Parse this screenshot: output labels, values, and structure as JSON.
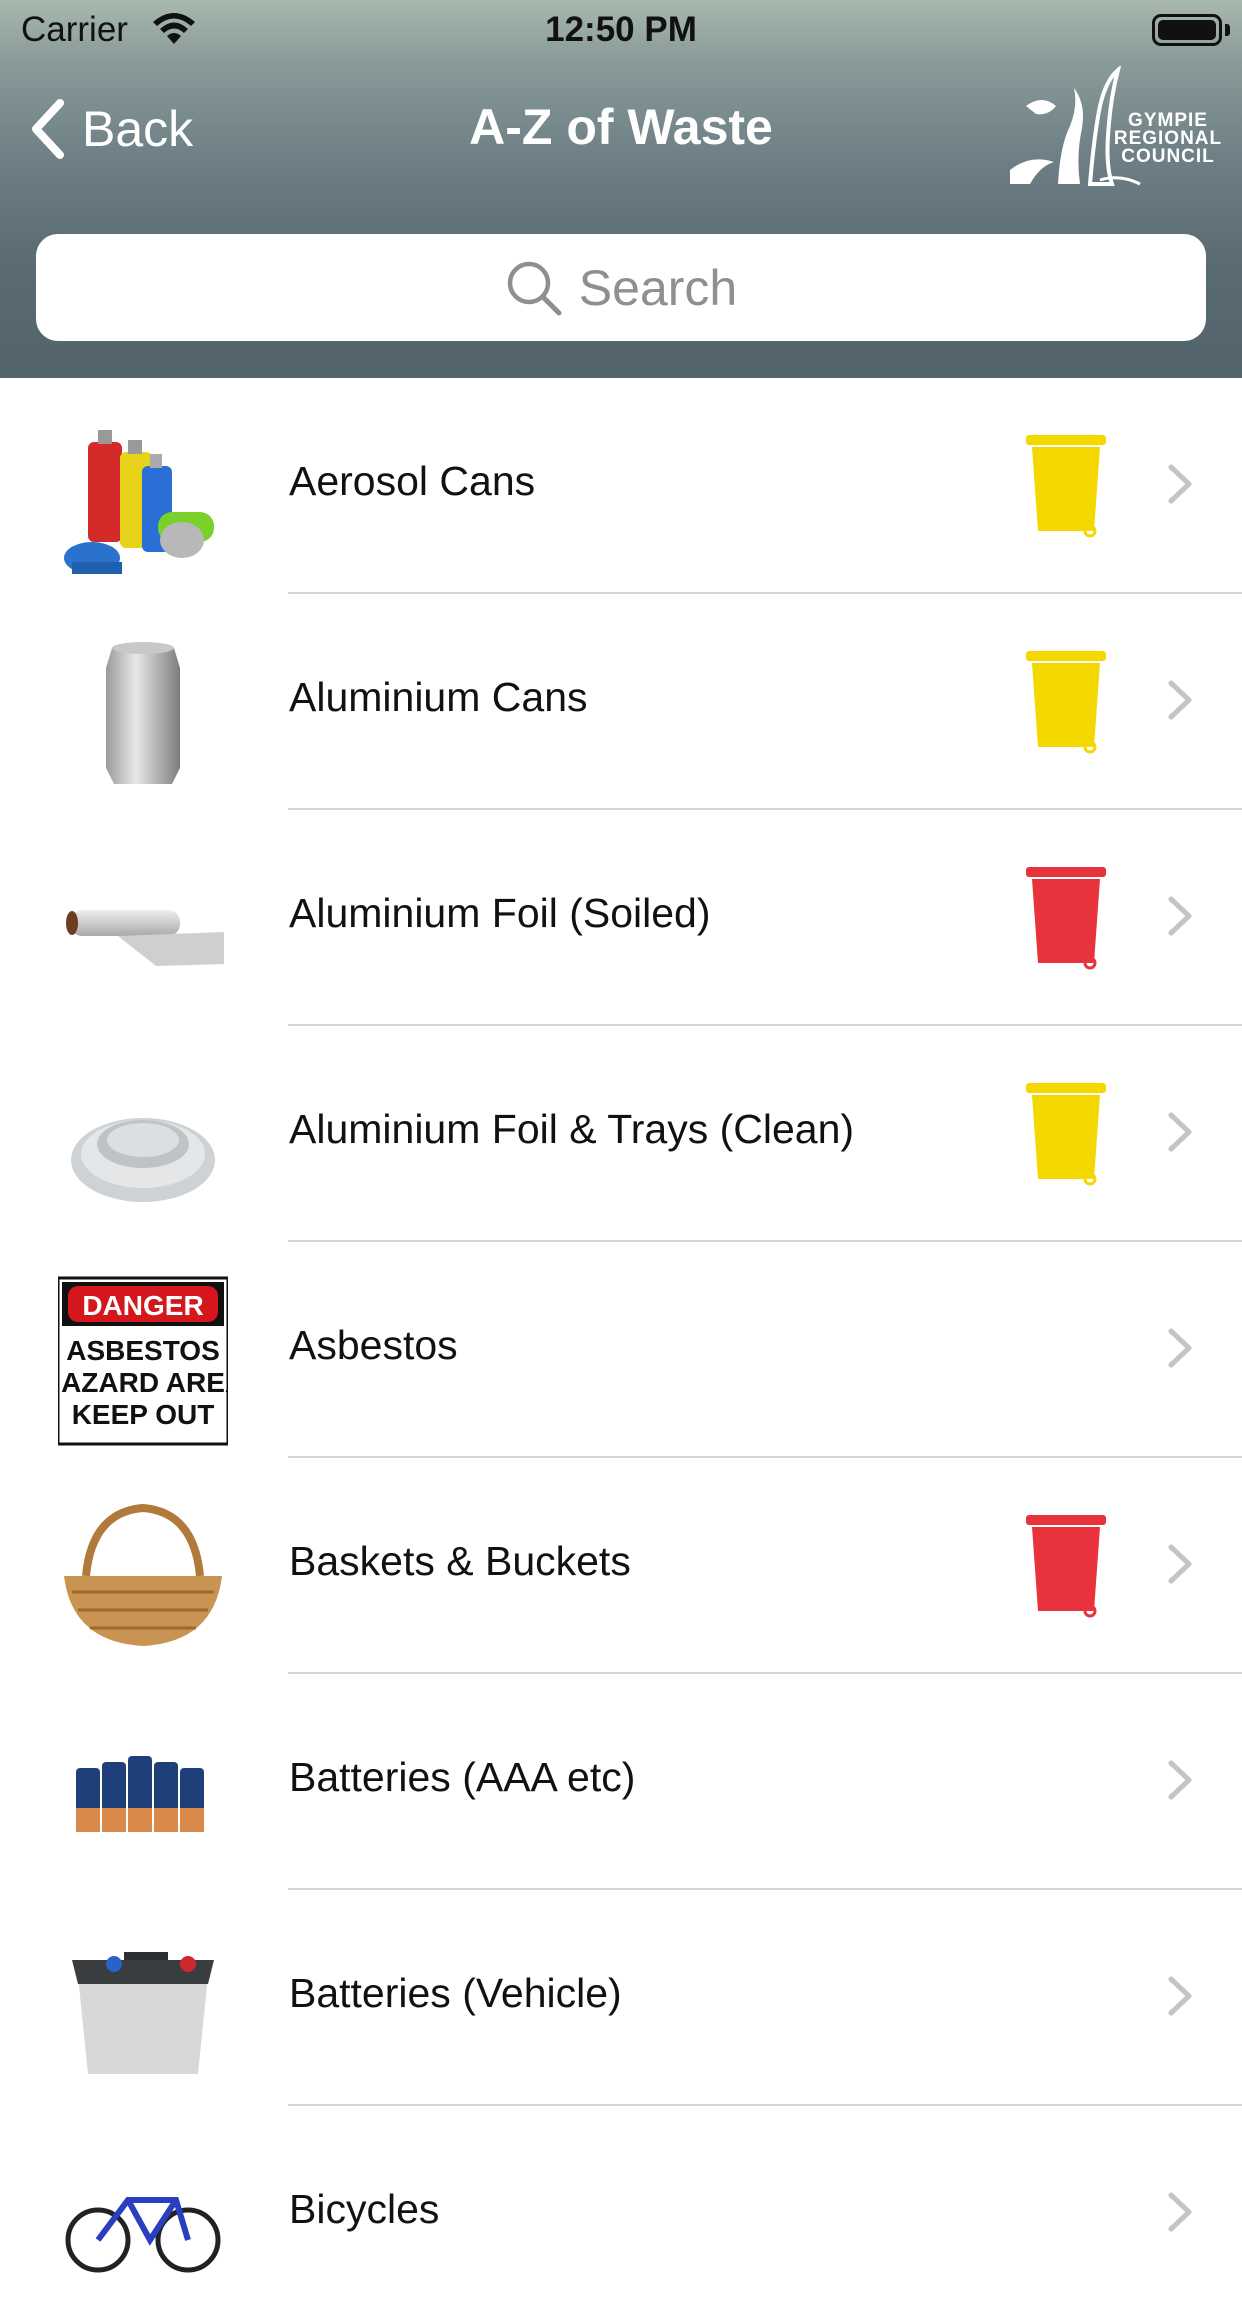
{
  "status_bar": {
    "carrier": "Carrier",
    "time": "12:50 PM"
  },
  "nav": {
    "back_label": "Back",
    "title": "A-Z of Waste",
    "logo_lines": [
      "GYMPIE",
      "REGIONAL",
      "COUNCIL"
    ]
  },
  "search": {
    "placeholder": "Search"
  },
  "colors": {
    "yellow_bin": "#f5d800",
    "red_bin": "#e8323c",
    "chevron": "#c4c4c7"
  },
  "items": [
    {
      "label": "Aerosol Cans",
      "icon": "aerosol-cans-icon",
      "bin": "yellow"
    },
    {
      "label": "Aluminium Cans",
      "icon": "aluminium-can-icon",
      "bin": "yellow"
    },
    {
      "label": "Aluminium Foil (Soiled)",
      "icon": "foil-roll-icon",
      "bin": "red"
    },
    {
      "label": "Aluminium Foil & Trays (Clean)",
      "icon": "foil-trays-icon",
      "bin": "yellow"
    },
    {
      "label": "Asbestos",
      "icon": "danger-sign-icon",
      "bin": "none",
      "sign_text": [
        "DANGER",
        "ASBESTOS",
        "HAZARD AREA",
        "KEEP OUT"
      ]
    },
    {
      "label": "Baskets & Buckets",
      "icon": "basket-icon",
      "bin": "red"
    },
    {
      "label": "Batteries (AAA etc)",
      "icon": "batteries-icon",
      "bin": "none"
    },
    {
      "label": "Batteries (Vehicle)",
      "icon": "car-battery-icon",
      "bin": "none"
    },
    {
      "label": "Bicycles",
      "icon": "bicycle-icon",
      "bin": "none"
    }
  ]
}
